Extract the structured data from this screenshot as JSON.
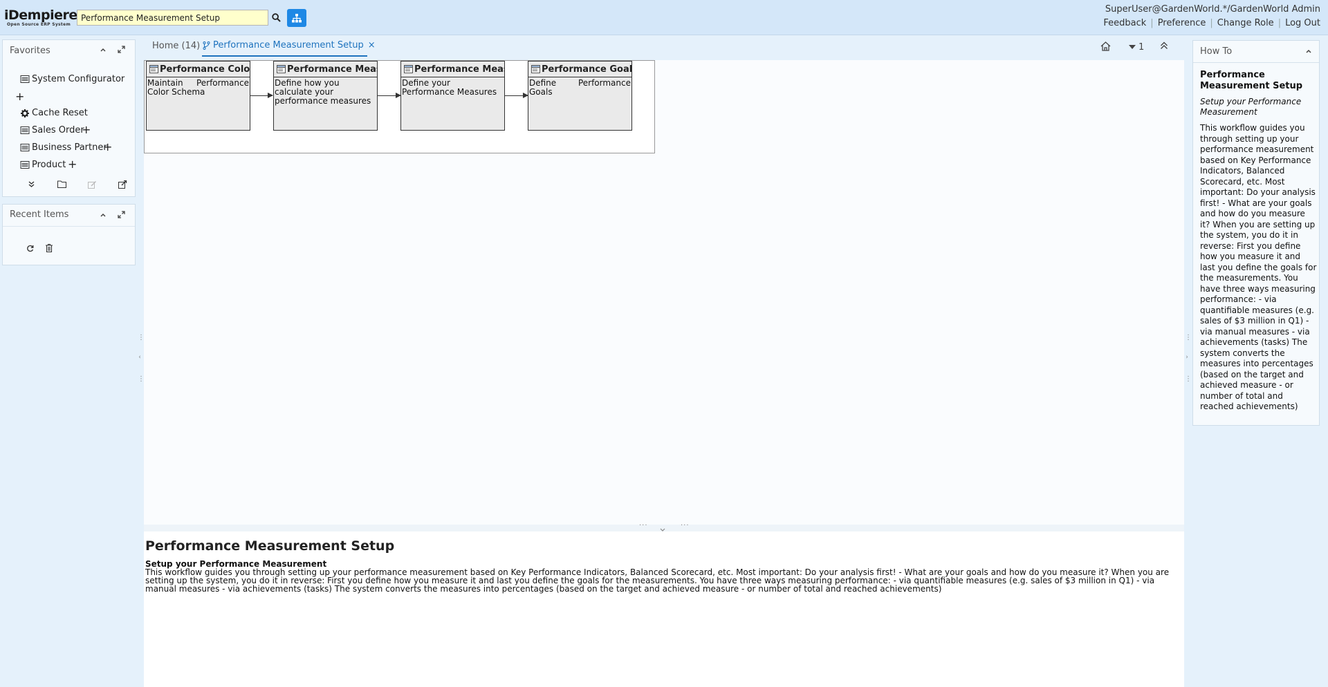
{
  "header": {
    "logo_main": "iDempiere",
    "logo_sub": "Open Source ERP System",
    "search_value": "Performance Measurement Setup",
    "user": "SuperUser@GardenWorld.*/GardenWorld Admin",
    "links": [
      "Feedback",
      "Preference",
      "Change Role",
      "Log Out"
    ]
  },
  "favorites": {
    "title": "Favorites",
    "items": [
      "System Configurator",
      "Cache Reset",
      "Sales Order",
      "Business Partner",
      "Product"
    ]
  },
  "recent": {
    "title": "Recent Items"
  },
  "tabs": {
    "home": "Home (14)",
    "active": "Performance Measurement Setup",
    "close": "×"
  },
  "toolbar": {
    "count": "1"
  },
  "workflow": {
    "nodes": [
      {
        "title": "Performance Color Schema",
        "desc": "Maintain Performance Color Schema"
      },
      {
        "title": "Performance Measure Calculation",
        "desc": "Define how you calculate your performance measures"
      },
      {
        "title": "Performance Measure",
        "desc": "Define your Performance Measures"
      },
      {
        "title": "Performance Goal",
        "desc": "Define Performance Goals"
      }
    ]
  },
  "detail": {
    "title": "Performance Measurement Setup",
    "subtitle": "Setup your Performance Measurement",
    "text": "This workflow guides you through setting up your performance measurement based on Key Performance Indicators, Balanced Scorecard, etc. Most important: Do your analysis first! - What are your goals and how do you measure it? When you are setting up the system, you do it in reverse: First you define how you measure it and last you define the goals for the measurements. You have three ways measuring performance: - via quantifiable measures (e.g. sales of $3 million in Q1) - via manual measures - via achievements (tasks) The system converts the measures into percentages (based on the target and achieved measure - or number of total and reached achievements)"
  },
  "howto": {
    "title": "How To",
    "heading": "Performance Measurement Setup",
    "subheading": "Setup your Performance Measurement",
    "body": "This workflow guides you through setting up your performance measurement based on Key Performance Indicators, Balanced Scorecard, etc. Most important: Do your analysis first! - What are your goals and how do you measure it? When you are setting up the system, you do it in reverse: First you define how you measure it and last you define the goals for the measurements. You have three ways measuring performance: - via quantifiable measures (e.g. sales of $3 million in Q1) - via manual measures - via achievements (tasks) The system converts the measures into percentages (based on the target and achieved measure - or number of total and reached achievements)"
  }
}
